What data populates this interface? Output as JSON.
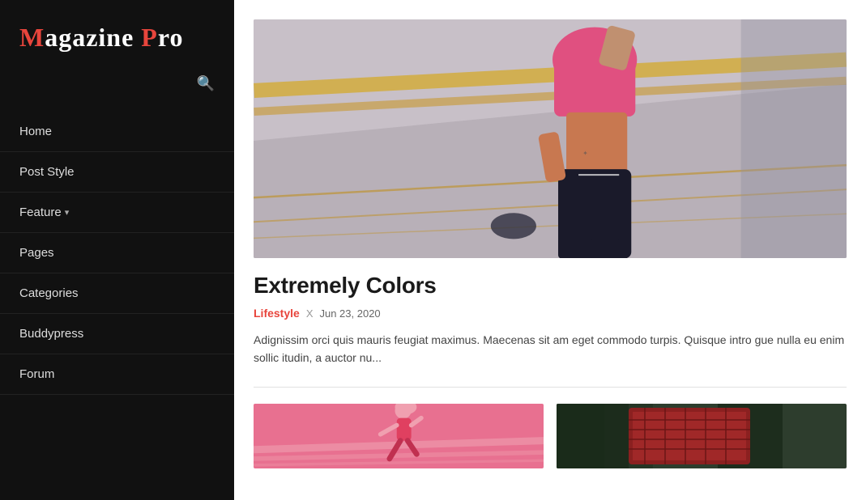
{
  "sidebar": {
    "logo": {
      "m": "M",
      "agazine": "agazine",
      "p": "P",
      "ro": "ro"
    },
    "nav_items": [
      {
        "label": "Home",
        "has_dropdown": false
      },
      {
        "label": "Post Style",
        "has_dropdown": false
      },
      {
        "label": "Feature",
        "has_dropdown": true
      },
      {
        "label": "Pages",
        "has_dropdown": false
      },
      {
        "label": "Categories",
        "has_dropdown": false
      },
      {
        "label": "Buddypress",
        "has_dropdown": false
      },
      {
        "label": "Forum",
        "has_dropdown": false
      }
    ]
  },
  "main": {
    "featured": {
      "title": "Extremely Colors",
      "category": "Lifestyle",
      "separator": "X",
      "date": "Jun 23, 2020",
      "excerpt": "Adignissim orci quis mauris feugiat maximus. Maecenas sit am eget commodo turpis. Quisque intro gue nulla eu enim sollic itudin, a auctor nu..."
    },
    "bottom_cards": [
      {
        "id": "card-1"
      },
      {
        "id": "card-2"
      }
    ]
  },
  "icons": {
    "search": "🔍",
    "chevron": "▾"
  }
}
